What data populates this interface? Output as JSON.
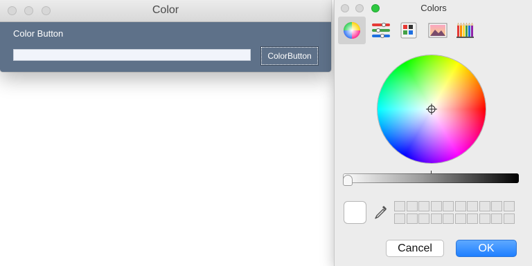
{
  "color_window": {
    "title": "Color",
    "label": "Color Button",
    "field_value": "",
    "button_label": "ColorButton",
    "background_color": "#5e7189"
  },
  "colors_panel": {
    "title": "Colors",
    "tabs": [
      {
        "icon": "color-wheel-icon",
        "active": true
      },
      {
        "icon": "color-sliders-icon",
        "active": false
      },
      {
        "icon": "color-palettes-icon",
        "active": false
      },
      {
        "icon": "image-palettes-icon",
        "active": false
      },
      {
        "icon": "pencils-icon",
        "active": false
      }
    ],
    "brightness_level": 0,
    "selected_color": "#ffffff",
    "cancel_label": "Cancel",
    "ok_label": "OK"
  }
}
